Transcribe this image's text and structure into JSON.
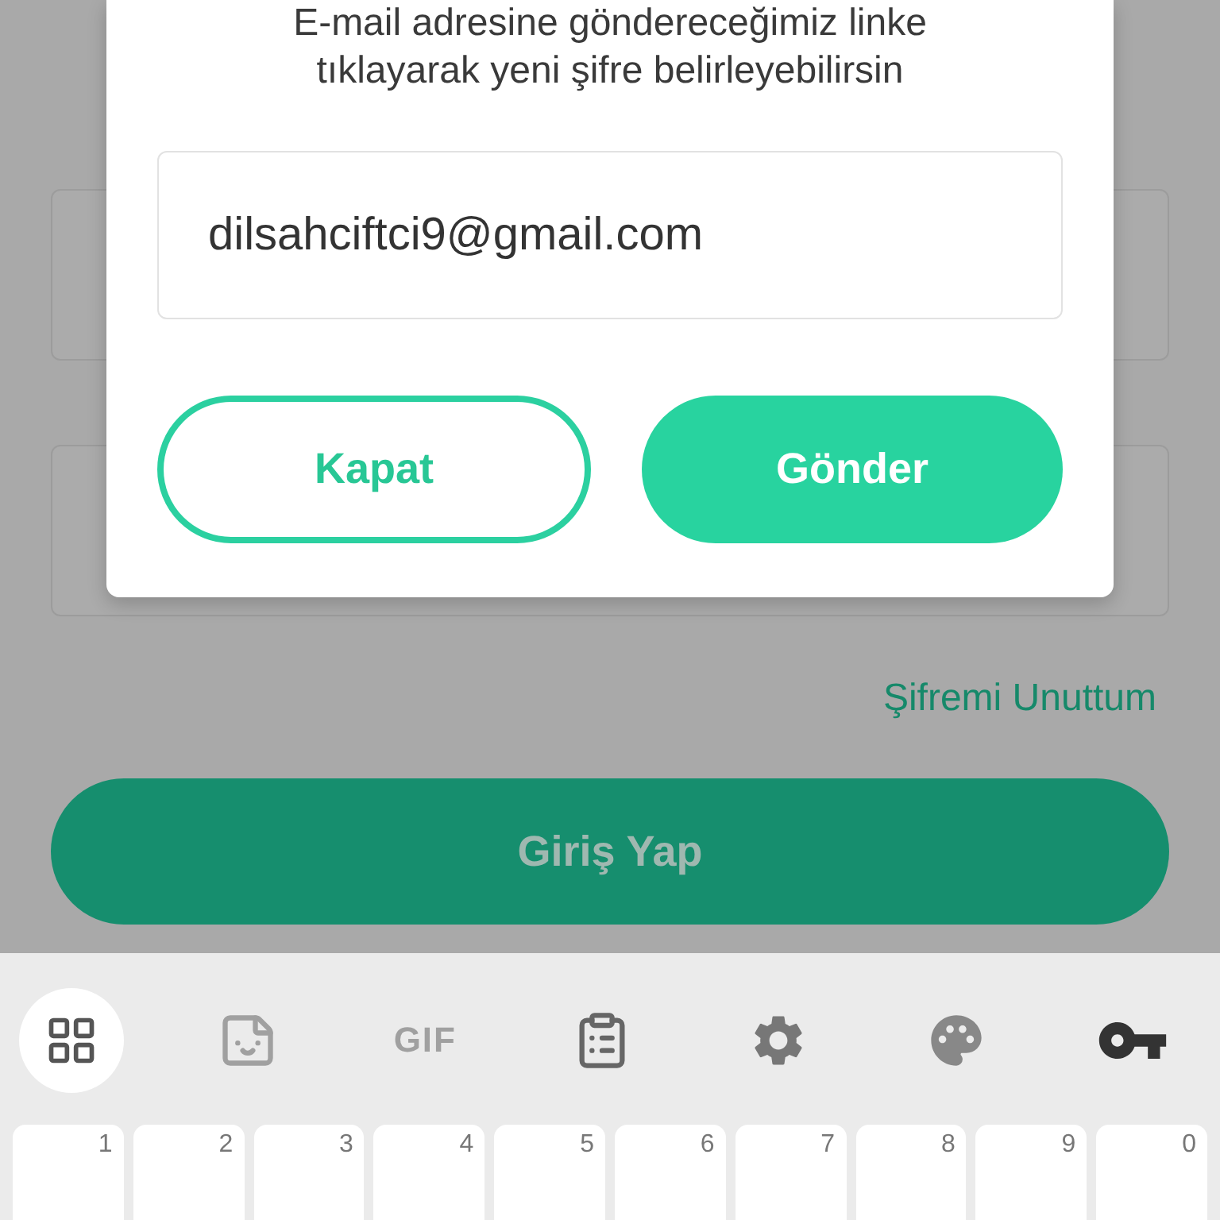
{
  "dialog": {
    "message_lines": [
      "E-mail adresine göndereceğimiz linke",
      "tıklayarak yeni şifre belirleyebilirsin"
    ],
    "email_field": {
      "value": "dilsahciftci9@gmail.com"
    },
    "buttons": [
      {
        "label": "Kapat",
        "kind": "outline"
      },
      {
        "label": "Gönder",
        "kind": "filled"
      }
    ]
  },
  "login": {
    "forgot_link": "Şifremi Unuttum",
    "submit_button": "Giriş Yap"
  },
  "keyboard": {
    "toolbar": [
      {
        "kind": "apps",
        "selected": true,
        "disabled": false
      },
      {
        "kind": "sticker",
        "selected": false,
        "disabled": true
      },
      {
        "kind": "gif",
        "label": "GIF",
        "selected": false,
        "disabled": true
      },
      {
        "kind": "clipboard",
        "selected": false,
        "disabled": false
      },
      {
        "kind": "settings",
        "selected": false,
        "disabled": false
      },
      {
        "kind": "theme",
        "selected": false,
        "disabled": false
      },
      {
        "kind": "password",
        "selected": false,
        "disabled": false
      }
    ],
    "keys": [
      {
        "hint": "1"
      },
      {
        "hint": "2"
      },
      {
        "hint": "3"
      },
      {
        "hint": "4"
      },
      {
        "hint": "5"
      },
      {
        "hint": "6"
      },
      {
        "hint": "7"
      },
      {
        "hint": "8"
      },
      {
        "hint": "9"
      },
      {
        "hint": "0"
      }
    ]
  }
}
